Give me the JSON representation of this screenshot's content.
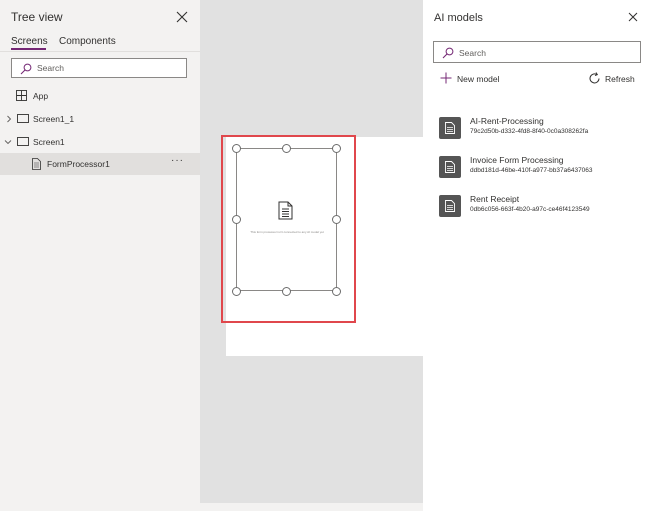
{
  "tree_view": {
    "title": "Tree view",
    "tabs": [
      {
        "label": "Screens",
        "active": true
      },
      {
        "label": "Components",
        "active": false
      }
    ],
    "search_placeholder": "Search",
    "items": [
      {
        "label": "App",
        "icon": "app-grid-icon"
      },
      {
        "label": "Screen1_1",
        "icon": "screen-icon",
        "expanded": false
      },
      {
        "label": "Screen1",
        "icon": "screen-icon",
        "expanded": true
      },
      {
        "label": "FormProcessor1",
        "icon": "form-document-icon",
        "selected": true,
        "more": "···"
      }
    ]
  },
  "canvas": {
    "form_note": "This form processor isn't connected to any AI model yet"
  },
  "ai_models": {
    "title": "AI models",
    "search_placeholder": "Search",
    "new_model_label": "New model",
    "refresh_label": "Refresh",
    "models": [
      {
        "name": "AI-Rent-Processing",
        "id": "79c2d50b-d332-4fd8-8f40-0c0a308262fa"
      },
      {
        "name": "Invoice Form Processing",
        "id": "ddbd181d-46be-410f-a977-bb37a6437063"
      },
      {
        "name": "Rent Receipt",
        "id": "0db6c056-663f-4b20-a97c-ce46f4123549"
      }
    ]
  },
  "colors": {
    "accent": "#742774",
    "highlight": "#e0474c",
    "tile": "#555555"
  }
}
